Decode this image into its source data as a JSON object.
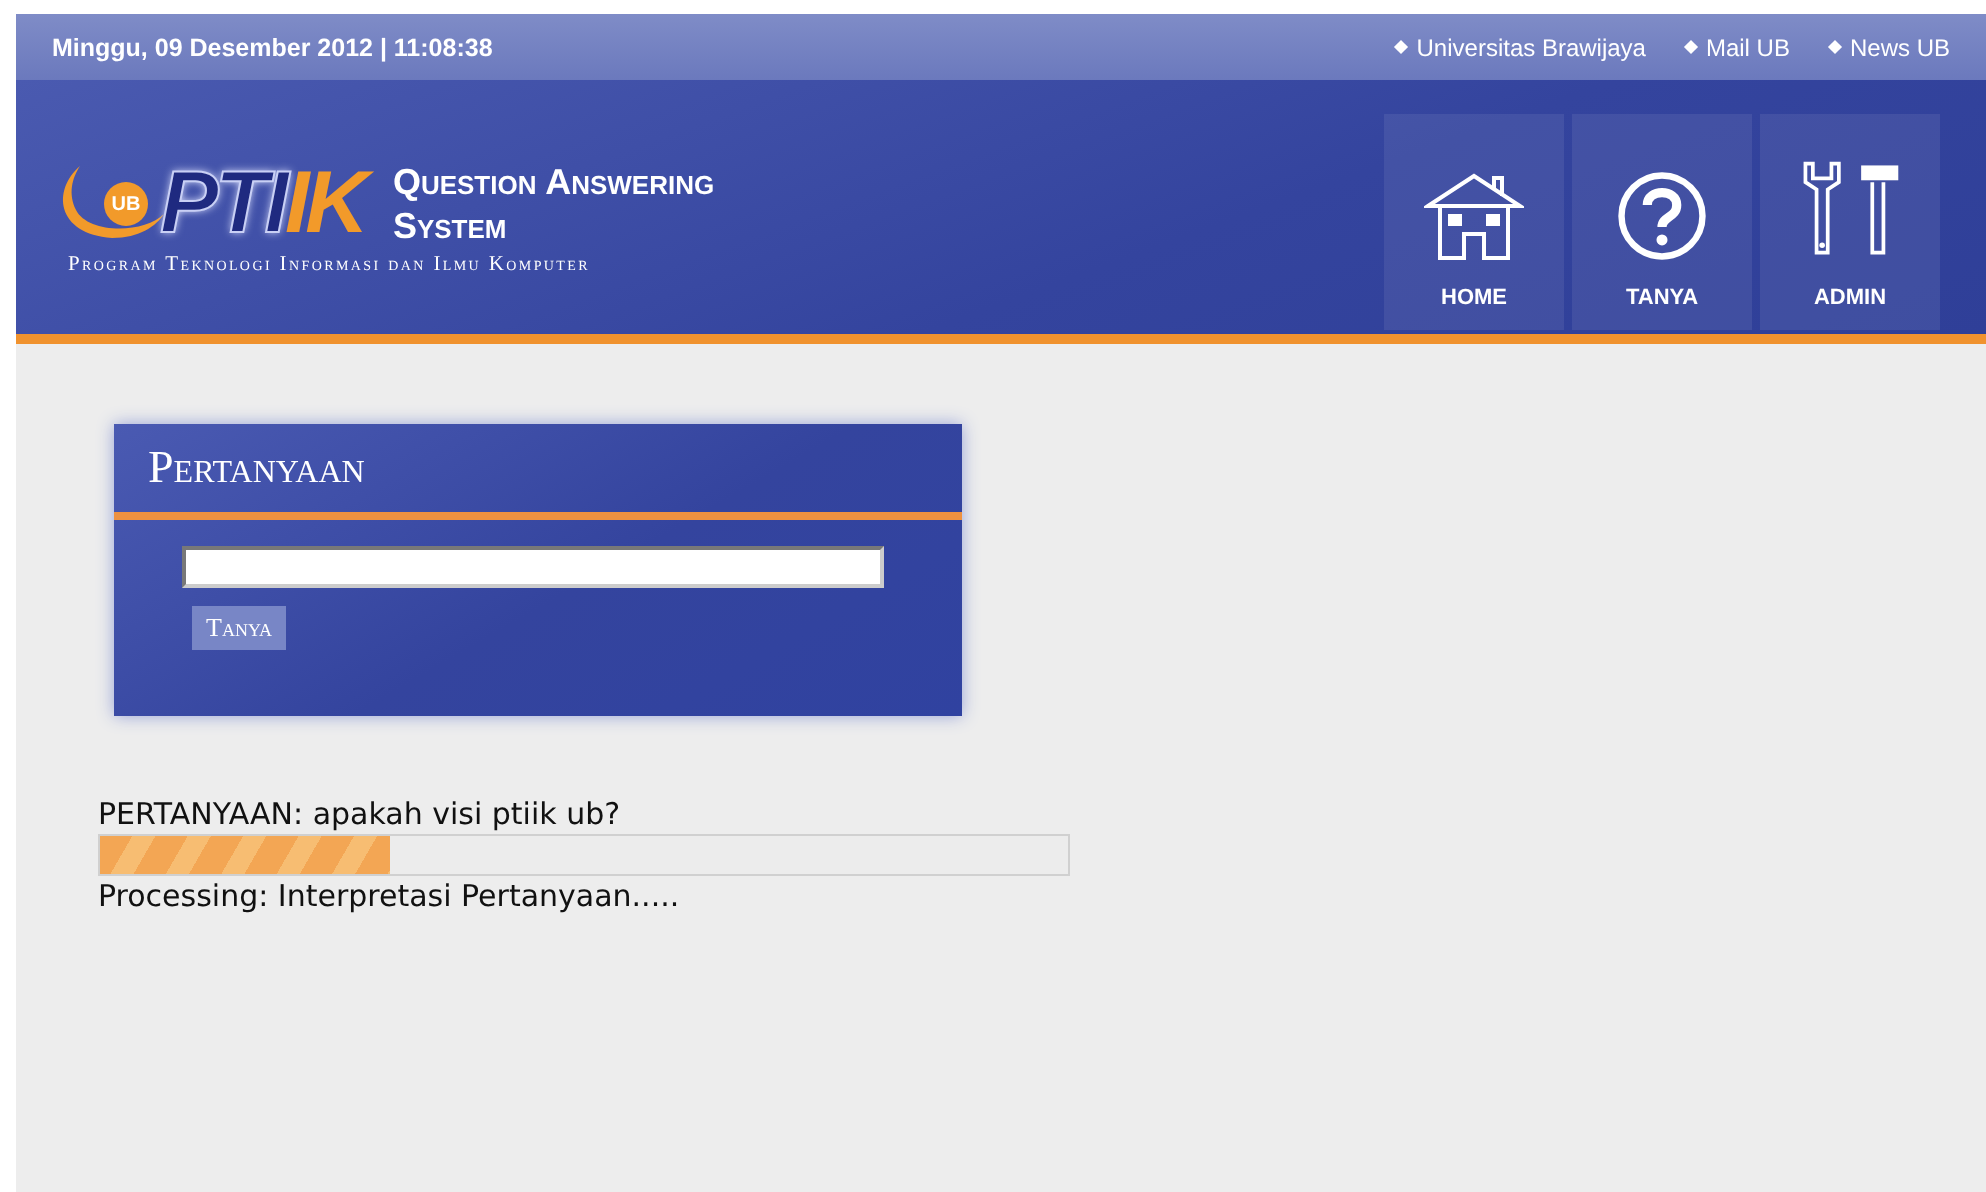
{
  "top_bar": {
    "datetime": "Minggu, 09 Desember 2012 | 11:08:38",
    "links": [
      {
        "label": "Universitas Brawijaya"
      },
      {
        "label": "Mail UB"
      },
      {
        "label": "News UB"
      }
    ]
  },
  "logo": {
    "badge": "UB",
    "wordmark_primary": "PTI",
    "wordmark_accent": "IK",
    "tagline": "Program Teknologi Informasi dan Ilmu Komputer"
  },
  "app_title": {
    "line_1": "Question Answering",
    "line_2": "System"
  },
  "nav": [
    {
      "label": "HOME"
    },
    {
      "label": "TANYA"
    },
    {
      "label": "ADMIN"
    }
  ],
  "panel": {
    "title": "Pertanyaan",
    "button": "Tanya"
  },
  "result": {
    "question": "PERTANYAAN: apakah visi ptiik ub?",
    "progress": {
      "level": 0.3
    },
    "status": "Processing: Interpretasi Pertanyaan....."
  }
}
